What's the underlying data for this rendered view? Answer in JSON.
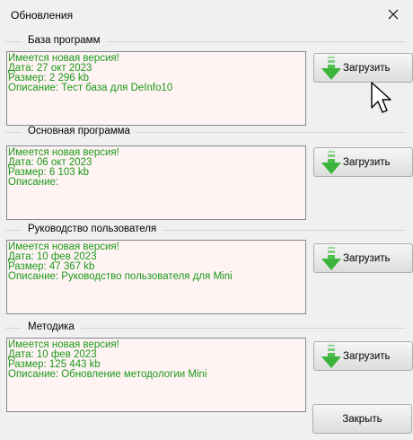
{
  "window": {
    "title": "Обновления"
  },
  "groups": [
    {
      "legend": "База программ",
      "lines": [
        "Имеется новая версия!",
        "Дата: 27 окт 2023",
        "Размер: 2 296 kb",
        "Описание: Тест база для DeInfo10"
      ],
      "button": "Загрузить"
    },
    {
      "legend": "Основная программа",
      "lines": [
        "Имеется новая версия!",
        "Дата: 06 окт 2023",
        "Размер: 6 103 kb",
        "Описание:"
      ],
      "button": "Загрузить"
    },
    {
      "legend": "Руководство пользователя",
      "lines": [
        "Имеется новая версия!",
        "Дата: 10 фев 2023",
        "Размер: 47 367 kb",
        "Описание: Руководство пользователя для Mini"
      ],
      "button": "Загрузить"
    },
    {
      "legend": "Методика",
      "lines": [
        "Имеется новая версия!",
        "Дата: 10 фев 2023",
        "Размер: 125 443 kb",
        "Описание: Обновление методологии Mini"
      ],
      "button": "Загрузить"
    }
  ],
  "footer": {
    "close_label": "Закрыть"
  },
  "icons": {
    "download": "download-arrow-icon",
    "close": "close-icon",
    "cursor": "mouse-pointer-icon"
  },
  "colors": {
    "info_text": "#1a9a1a",
    "info_bg": "#fff3f3",
    "arrow": "#3cb43c"
  }
}
